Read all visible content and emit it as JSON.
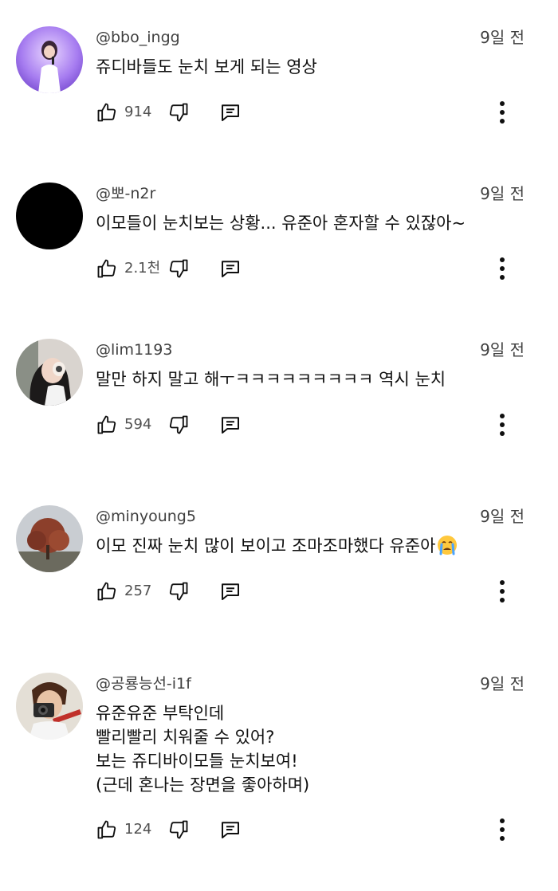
{
  "comments": [
    {
      "handle": "@bbo_ingg",
      "time": "9일 전",
      "lines": [
        "쥬디바들도 눈치 보게 되는 영상"
      ],
      "likes": "914",
      "avatar": "concert-singer-avatar"
    },
    {
      "handle": "@뽀-n2r",
      "time": "9일 전",
      "lines": [
        "이모들이 눈치보는 상황... 유준아 혼자할 수 있잖아~"
      ],
      "likes": "2.1천",
      "avatar": "black-circle-avatar"
    },
    {
      "handle": "@lim1193",
      "time": "9일 전",
      "lines": [
        "말만 하지 말고 해ㅜㅋㅋㅋㅋㅋㅋㅋㅋㅋ 역시 눈치"
      ],
      "likes": "594",
      "avatar": "selfie-avatar"
    },
    {
      "handle": "@minyoung5",
      "time": "9일 전",
      "lines": [
        "이모 진짜 눈치 많이 보이고 조마조마했다 유준아"
      ],
      "emoji": "crying-face-emoji",
      "likes": "257",
      "avatar": "autumn-tree-avatar"
    },
    {
      "handle": "@공룡능선-i1f",
      "time": "9일 전",
      "lines": [
        "유준유준 부탁인데",
        "빨리빨리 치워줄 수 있어?",
        "보는 쥬디바이모들 눈치보여!",
        "(근데 혼나는 장면을 좋아하며)"
      ],
      "likes": "124",
      "avatar": "camera-person-avatar"
    }
  ],
  "icons": {
    "like": "thumbs-up-icon",
    "dislike": "thumbs-down-icon",
    "reply": "reply-comment-icon",
    "more": "more-vertical-icon"
  },
  "colors": {
    "text": "#0f0f0f",
    "meta": "#3f3f3f",
    "icon": "#0f0f0f",
    "background": "#ffffff"
  }
}
